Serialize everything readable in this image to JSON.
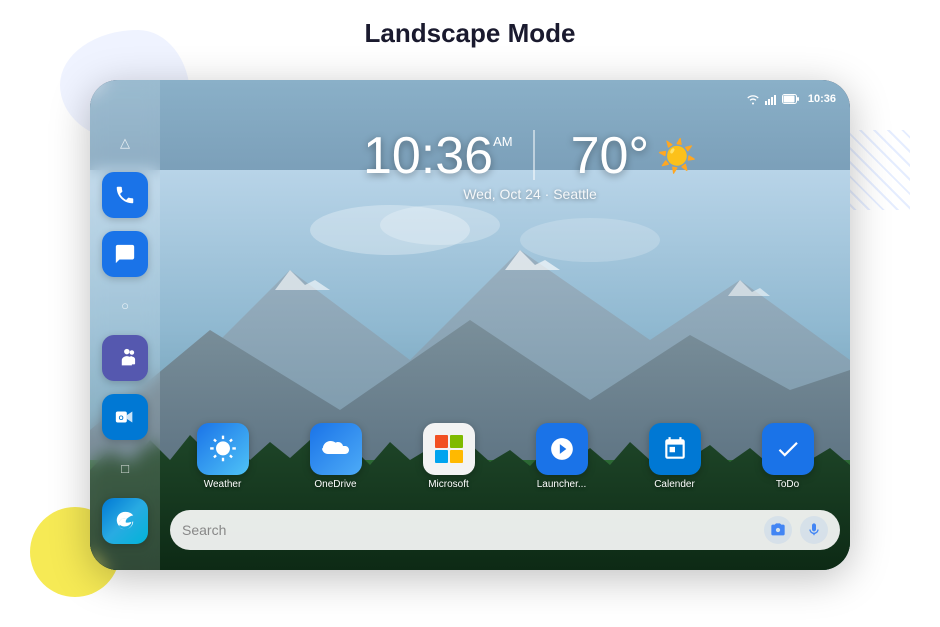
{
  "page": {
    "title": "Landscape Mode",
    "background_color": "#ffffff"
  },
  "status_bar": {
    "time": "10:36",
    "icons": [
      "wifi",
      "signal",
      "battery"
    ]
  },
  "clock_widget": {
    "time": "10:36",
    "ampm": "AM",
    "temperature": "70°",
    "date": "Wed, Oct 24  ·  Seattle"
  },
  "sidebar_nav": [
    {
      "name": "back",
      "symbol": "△"
    },
    {
      "name": "home",
      "symbol": "○"
    },
    {
      "name": "recents",
      "symbol": "□"
    }
  ],
  "sidebar_apps": [
    {
      "name": "Phone",
      "icon_type": "phone"
    },
    {
      "name": "Messages",
      "icon_type": "messages"
    },
    {
      "name": "Teams",
      "icon_type": "teams"
    },
    {
      "name": "Outlook",
      "icon_type": "outlook"
    },
    {
      "name": "Edge",
      "icon_type": "edge"
    }
  ],
  "app_grid": [
    {
      "name": "Weather",
      "icon_type": "weather"
    },
    {
      "name": "OneDrive",
      "icon_type": "onedrive"
    },
    {
      "name": "Microsoft",
      "icon_type": "microsoft"
    },
    {
      "name": "Launcher...",
      "icon_type": "launcher"
    },
    {
      "name": "Calender",
      "icon_type": "calendar"
    },
    {
      "name": "ToDo",
      "icon_type": "todo"
    }
  ],
  "search_bar": {
    "placeholder": "Search"
  }
}
